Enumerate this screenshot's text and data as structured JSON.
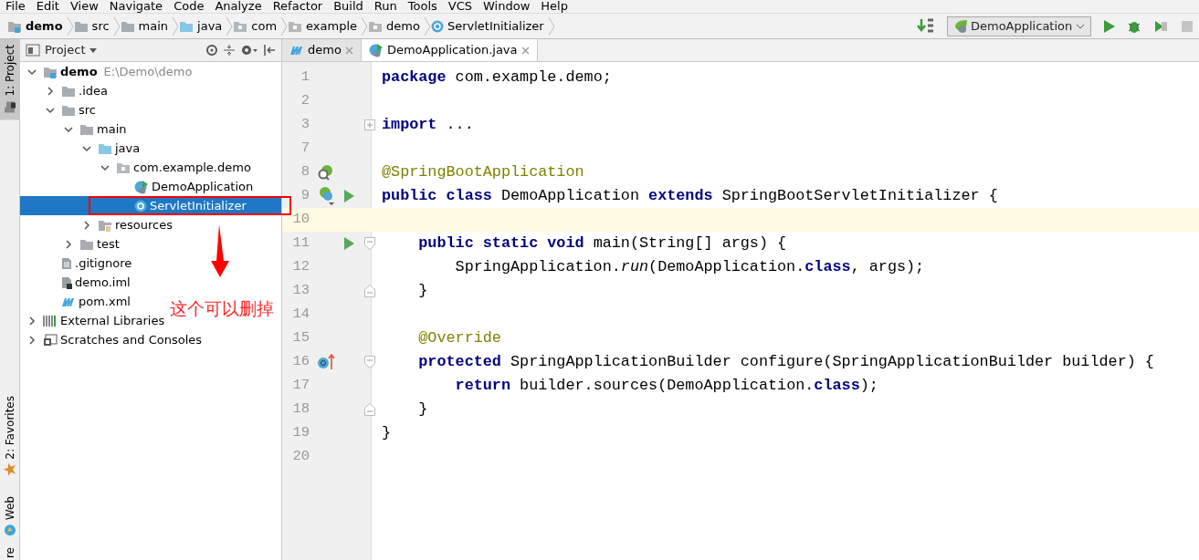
{
  "menu": [
    "File",
    "Edit",
    "View",
    "Navigate",
    "Code",
    "Analyze",
    "Refactor",
    "Build",
    "Run",
    "Tools",
    "VCS",
    "Window",
    "Help"
  ],
  "breadcrumbs": [
    {
      "label": "demo",
      "kind": "module",
      "bold": true
    },
    {
      "label": "src",
      "kind": "folder",
      "bold": false
    },
    {
      "label": "main",
      "kind": "folder",
      "bold": false
    },
    {
      "label": "java",
      "kind": "source",
      "bold": false
    },
    {
      "label": "com",
      "kind": "package",
      "bold": false
    },
    {
      "label": "example",
      "kind": "package",
      "bold": false
    },
    {
      "label": "demo",
      "kind": "package",
      "bold": false
    },
    {
      "label": "ServletInitializer",
      "kind": "class",
      "bold": false
    }
  ],
  "run_config": {
    "label": "DemoApplication"
  },
  "side_tabs": [
    {
      "label": "1: Project",
      "selected": true,
      "kind": "project"
    },
    {
      "label": "2: Favorites",
      "selected": false,
      "kind": "favorites"
    },
    {
      "label": "Web",
      "selected": false,
      "kind": "web"
    },
    {
      "label": "re",
      "selected": false,
      "kind": "plain"
    }
  ],
  "project_panel": {
    "title": "Project",
    "tree": [
      {
        "label": "demo",
        "path": "E:\\Demo\\demo",
        "kind": "module",
        "expanded": true,
        "selected": false,
        "children": [
          {
            "label": ".idea",
            "kind": "folder",
            "expanded": false,
            "selected": false
          },
          {
            "label": "src",
            "kind": "folder",
            "expanded": true,
            "selected": false,
            "children": [
              {
                "label": "main",
                "kind": "folder",
                "expanded": true,
                "selected": false,
                "children": [
                  {
                    "label": "java",
                    "kind": "source",
                    "expanded": true,
                    "selected": false,
                    "children": [
                      {
                        "label": "com.example.demo",
                        "kind": "package",
                        "expanded": true,
                        "selected": false,
                        "children": [
                          {
                            "label": "DemoApplication",
                            "kind": "spring-class",
                            "selected": false
                          },
                          {
                            "label": "ServletInitializer",
                            "kind": "class",
                            "selected": true
                          }
                        ]
                      }
                    ]
                  },
                  {
                    "label": "resources",
                    "kind": "resources",
                    "expanded": false,
                    "selected": false
                  }
                ]
              },
              {
                "label": "test",
                "kind": "folder",
                "expanded": false,
                "selected": false
              }
            ]
          },
          {
            "label": ".gitignore",
            "kind": "file",
            "selected": false
          },
          {
            "label": "demo.iml",
            "kind": "iml",
            "selected": false
          },
          {
            "label": "pom.xml",
            "kind": "maven",
            "selected": false
          }
        ]
      },
      {
        "label": "External Libraries",
        "kind": "libraries",
        "expanded": false,
        "selected": false
      },
      {
        "label": "Scratches and Consoles",
        "kind": "scratches",
        "expanded": false,
        "selected": false
      }
    ]
  },
  "editor_tabs": [
    {
      "label": "demo",
      "kind": "maven",
      "selected": false
    },
    {
      "label": "DemoApplication.java",
      "kind": "spring-class",
      "selected": true
    }
  ],
  "code_lines": [
    {
      "number": "1",
      "current": false,
      "text": "**package** com.example.demo;"
    },
    {
      "number": "2",
      "current": false
    },
    {
      "number": "3",
      "current": false,
      "markers": [
        {
          "kind": "fold-collapsed"
        }
      ],
      "text": "**import** ..."
    },
    {
      "number": "7",
      "current": false
    },
    {
      "number": "8",
      "current": false,
      "kind": "annotation",
      "markers": [
        {
          "kind": "spring-bean"
        }
      ],
      "text": "@SpringBootApplication"
    },
    {
      "number": "9",
      "current": false,
      "markers": [
        {
          "kind": "spring-class"
        },
        {
          "kind": "run"
        }
      ],
      "text": "**public class** DemoApplication **extends** SpringBootServletInitializer {"
    },
    {
      "number": "10",
      "current": true
    },
    {
      "number": "11",
      "current": false,
      "markers": [
        {
          "kind": "run"
        },
        {
          "kind": "fold-start"
        }
      ],
      "text": "    **public static void** main(String[] args) {"
    },
    {
      "number": "12",
      "current": false,
      "text": "        SpringApplication.*run*(DemoApplication.**class**, args);"
    },
    {
      "number": "13",
      "current": false,
      "markers": [
        {
          "kind": "fold-end"
        }
      ],
      "text": "    }"
    },
    {
      "number": "14",
      "current": false
    },
    {
      "number": "15",
      "current": false,
      "kind": "annotation",
      "text": "    @Override"
    },
    {
      "number": "16",
      "current": false,
      "markers": [
        {
          "kind": "override"
        },
        {
          "kind": "fold-start"
        }
      ],
      "text": "    **protected** SpringApplicationBuilder configure(SpringApplicationBuilder builder) {"
    },
    {
      "number": "17",
      "current": false,
      "text": "        **return** builder.sources(DemoApplication.**class**);"
    },
    {
      "number": "18",
      "current": false,
      "markers": [
        {
          "kind": "fold-end"
        }
      ],
      "text": "    }"
    },
    {
      "number": "19",
      "current": false,
      "text": "}"
    },
    {
      "number": "20",
      "current": false
    }
  ],
  "annotation": {
    "text": "这个可以删掉"
  }
}
